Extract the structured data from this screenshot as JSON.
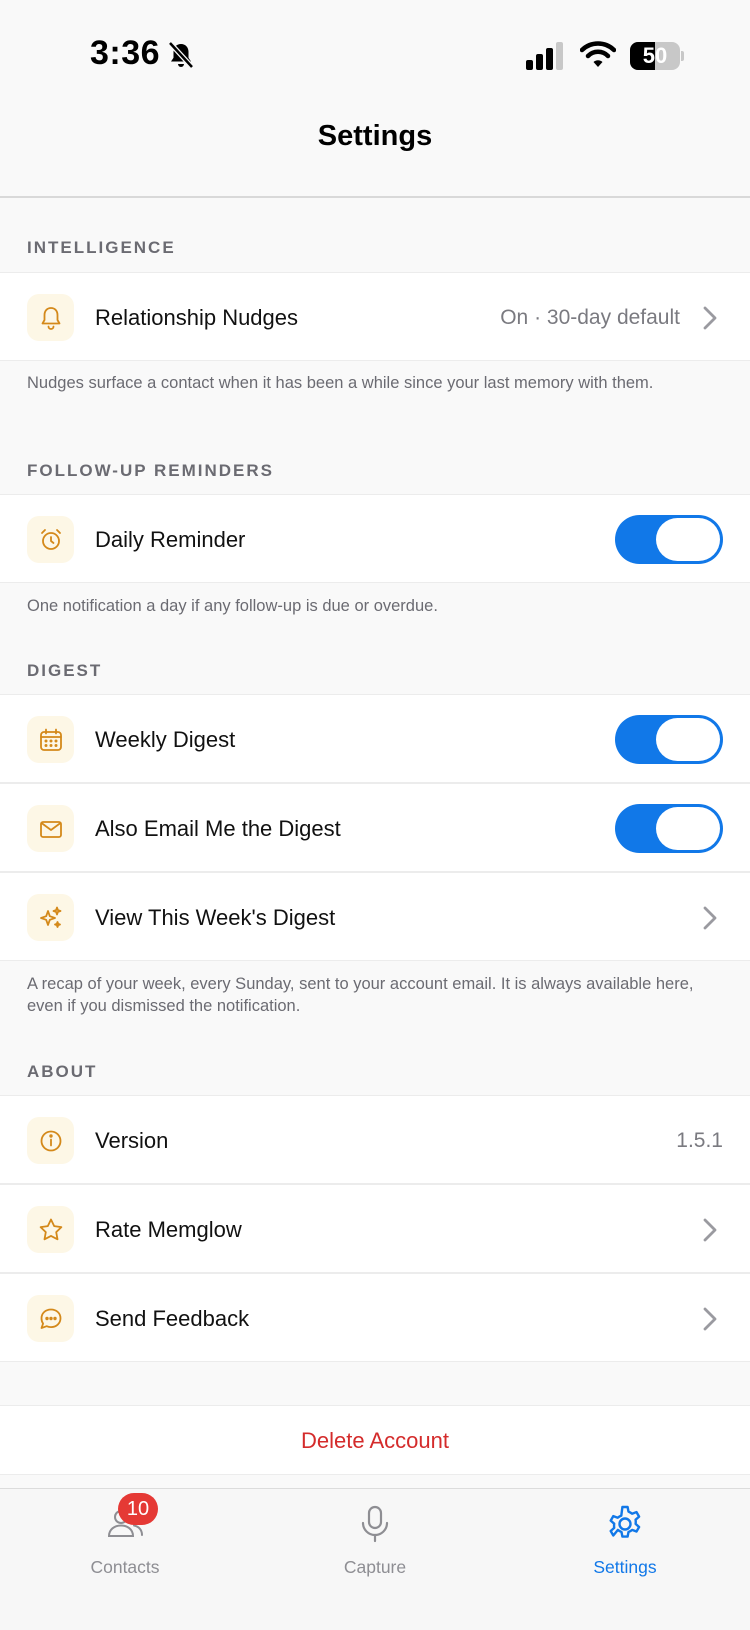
{
  "status_bar": {
    "time": "3:36",
    "battery": {
      "level_percent": 50,
      "label": "50"
    }
  },
  "nav": {
    "title": "Settings"
  },
  "sections": {
    "intelligence": {
      "header": "INTELLIGENCE",
      "nudges": {
        "label": "Relationship Nudges",
        "value": "On · 30-day default",
        "icon": "bell-icon"
      },
      "footnote": "Nudges surface a contact when it has been a while since your last memory with them."
    },
    "followup": {
      "header": "FOLLOW-UP REMINDERS",
      "daily": {
        "label": "Daily Reminder",
        "on": true,
        "icon": "alarm-clock-icon"
      },
      "footnote": "One notification a day if any follow-up is due or overdue."
    },
    "digest": {
      "header": "DIGEST",
      "weekly": {
        "label": "Weekly Digest",
        "on": true,
        "icon": "calendar-icon"
      },
      "email": {
        "label": "Also Email Me the Digest",
        "on": true,
        "icon": "envelope-icon"
      },
      "view": {
        "label": "View This Week's Digest",
        "icon": "sparkles-icon"
      },
      "footnote": "A recap of your week, every Sunday, sent to your account email. It is always available here, even if you dismissed the notification."
    },
    "about": {
      "header": "ABOUT",
      "version": {
        "label": "Version",
        "value": "1.5.1",
        "icon": "info-icon"
      },
      "rate": {
        "label": "Rate Memglow",
        "icon": "star-icon"
      },
      "feedback": {
        "label": "Send Feedback",
        "icon": "chat-bubble-icon"
      }
    }
  },
  "delete_account": "Delete Account",
  "tab_bar": {
    "contacts": {
      "label": "Contacts",
      "badge": "10",
      "icon": "contacts-icon"
    },
    "capture": {
      "label": "Capture",
      "icon": "microphone-icon"
    },
    "settings": {
      "label": "Settings",
      "icon": "gear-icon",
      "active": true
    }
  },
  "colors": {
    "accent": "#1178e8",
    "icon_orange": "#d4891a",
    "icon_bg": "#fdf7e6",
    "destructive": "#d42b2b",
    "badge": "#e53935"
  }
}
